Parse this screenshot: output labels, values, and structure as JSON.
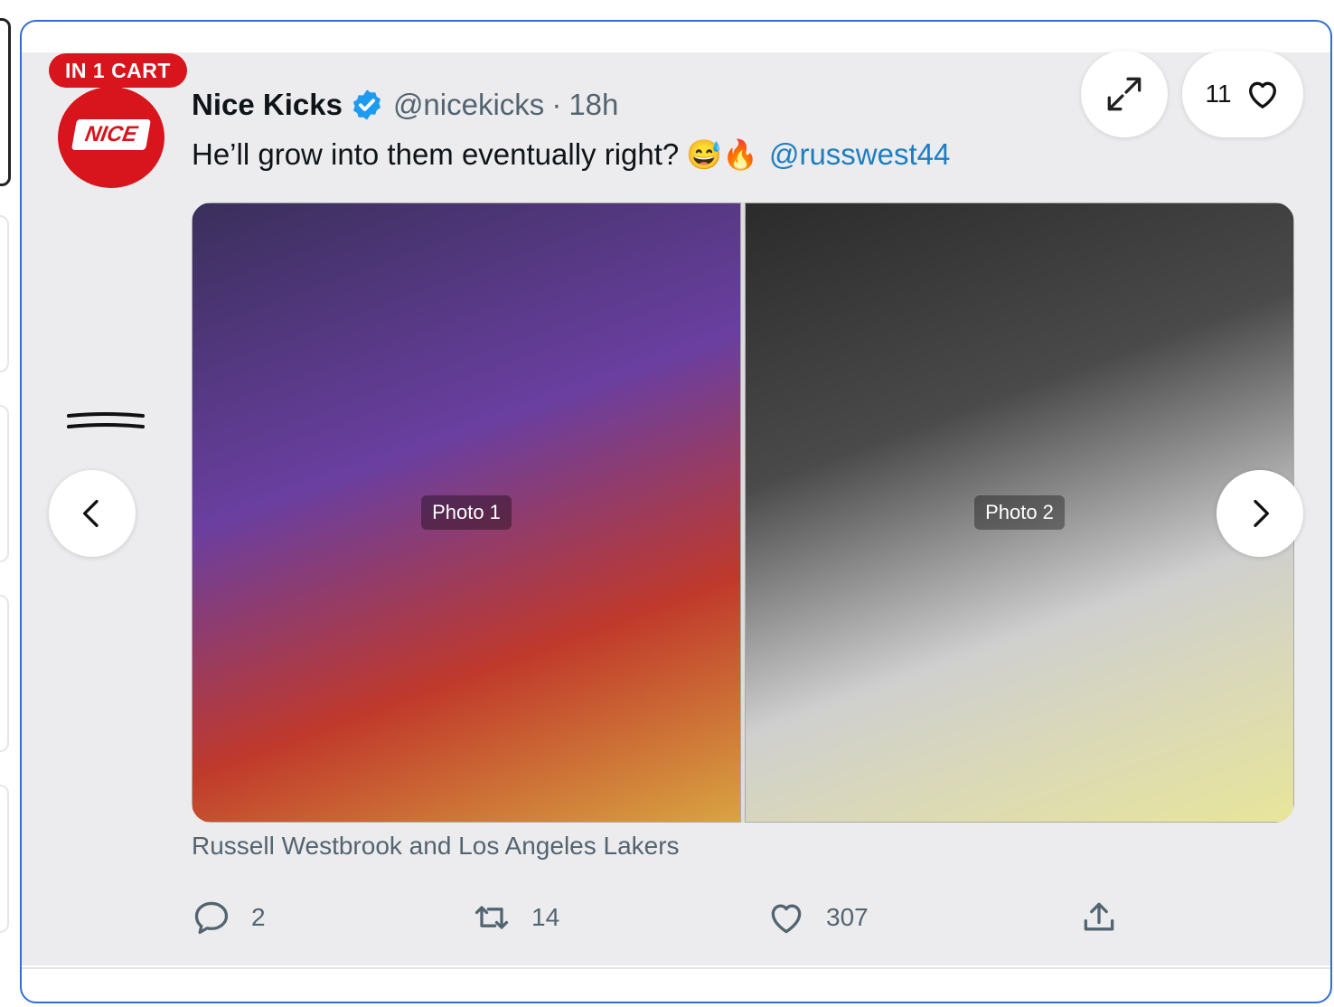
{
  "badge": {
    "label": "IN 1 CART"
  },
  "avatar": {
    "logo_text": "NICE"
  },
  "tweet": {
    "display_name": "Nice Kicks",
    "handle": "@nicekicks",
    "separator": "·",
    "time": "18h",
    "text": "He’ll grow into them eventually right?",
    "emojis": "😅🔥",
    "mention": "@russwest44",
    "caption": "Russell Westbrook and Los Angeles Lakers"
  },
  "media": {
    "photo_one_label": "Photo 1",
    "photo_two_label": "Photo 2"
  },
  "stats": {
    "replies": "2",
    "retweets": "14",
    "likes": "307"
  },
  "likes_button": {
    "count": "11"
  },
  "colors": {
    "badge": "#d8141c",
    "accent": "#2f6fd1",
    "mention": "#1d7ec2",
    "verified": "#1d9bf0"
  },
  "icons": {
    "expand": "expand-icon",
    "heart": "heart-icon",
    "reply": "reply-icon",
    "retweet": "retweet-icon",
    "share": "share-icon",
    "prev": "chevron-left-icon",
    "next": "chevron-right-icon",
    "verified": "verified-badge-icon",
    "drag": "drag-handle-icon"
  }
}
